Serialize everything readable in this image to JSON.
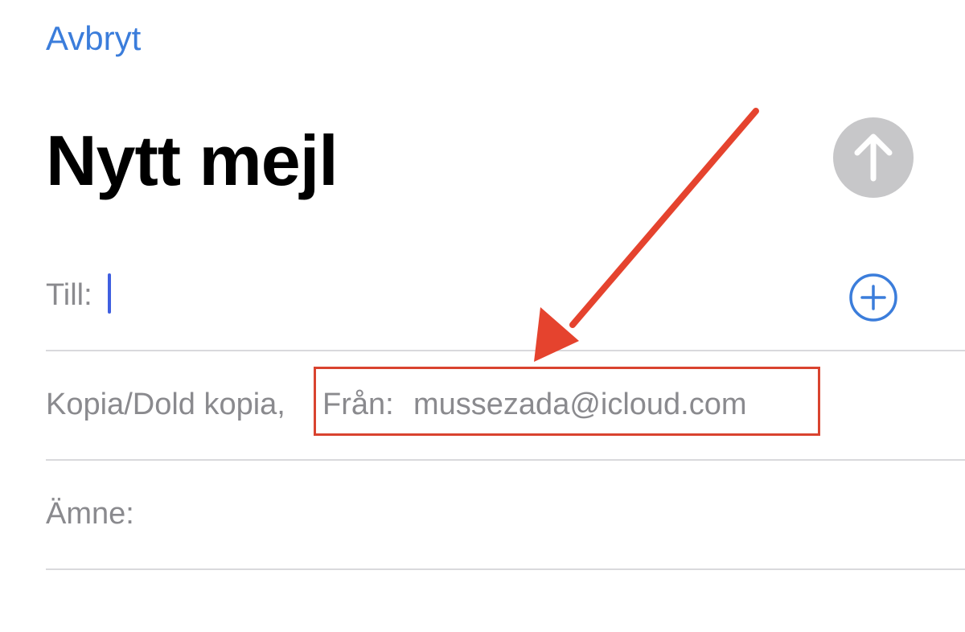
{
  "navigation": {
    "cancel_label": "Avbryt"
  },
  "compose": {
    "title": "Nytt mejl",
    "to_label": "Till:",
    "cc_bcc_label": "Kopia/Dold kopia,",
    "from_label": "Från:",
    "from_value": "mussezada@icloud.com",
    "subject_label": "Ämne:"
  },
  "icons": {
    "send": "arrow-up-icon",
    "add_contact": "plus-circle-icon",
    "annotation": "red-arrow-annotation"
  },
  "colors": {
    "accent": "#3b7ddb",
    "send_disabled": "#c7c7c9",
    "annotation_red": "#d9432f",
    "label_gray": "#8a8a8e",
    "cursor": "#3f5fe0"
  }
}
